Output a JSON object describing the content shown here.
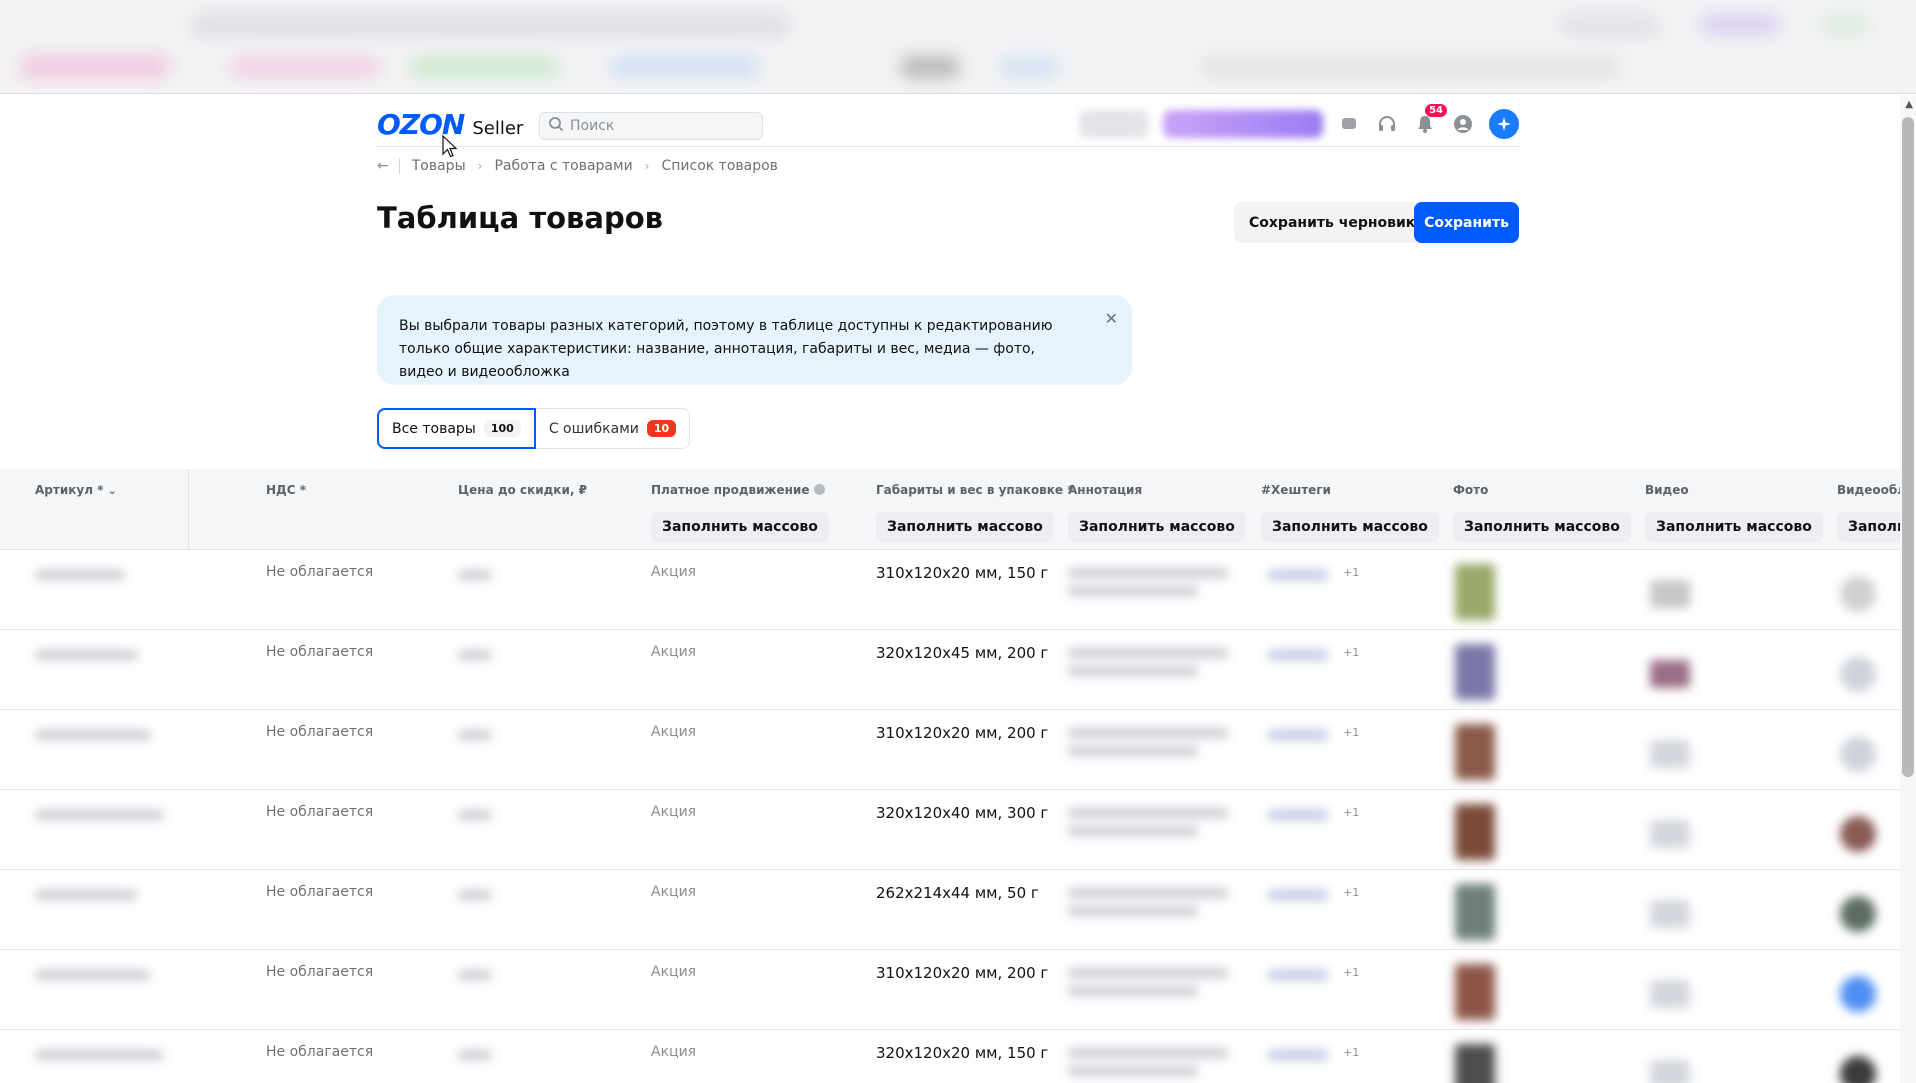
{
  "header": {
    "logo_brand": "OZON",
    "logo_product": "Seller",
    "search_placeholder": "Поиск",
    "notifications_count": "54",
    "icons": [
      "chat-icon",
      "support-icon",
      "bell-icon",
      "profile-icon",
      "ai-assistant-icon"
    ]
  },
  "breadcrumb": {
    "items": [
      "Товары",
      "Работа с товарами",
      "Список товаров"
    ]
  },
  "page": {
    "title": "Таблица товаров",
    "save_draft_label": "Сохранить черновик",
    "save_label": "Сохранить"
  },
  "notice": {
    "text": "Вы выбрали товары разных категорий, поэтому в таблице доступны к редактированию только общие характеристики: название, аннотация, габариты и вес, медиа — фото, видео и видеообложка"
  },
  "tabs": [
    {
      "label": "Все товары",
      "count": "100"
    },
    {
      "label": "С ошибками",
      "count": "10"
    }
  ],
  "table": {
    "columns": {
      "article": "Артикул *",
      "nds": "НДС *",
      "price": "Цена до скидки, ₽",
      "promo": "Платное продвижение",
      "dims": "Габариты и вес в упаковке *",
      "annotation": "Аннотация",
      "hashtags": "#Хештеги",
      "photo": "Фото",
      "video": "Видео",
      "video_cover": "Видеообл"
    },
    "fill_label": "Заполнить массово",
    "fill_label_cut": "Заполн",
    "rows": [
      {
        "nds": "Не облагается",
        "promo": "Акция",
        "dims": "310x120x20 мм, 150 г",
        "hashtag_extra": "+1"
      },
      {
        "nds": "Не облагается",
        "promo": "Акция",
        "dims": "320x120x45 мм, 200 г",
        "hashtag_extra": "+1"
      },
      {
        "nds": "Не облагается",
        "promo": "Акция",
        "dims": "310x120x20 мм, 200 г",
        "hashtag_extra": "+1"
      },
      {
        "nds": "Не облагается",
        "promo": "Акция",
        "dims": "320x120x40 мм, 300 г",
        "hashtag_extra": "+1"
      },
      {
        "nds": "Не облагается",
        "promo": "Акция",
        "dims": "262x214x44 мм, 50 г",
        "hashtag_extra": "+1"
      },
      {
        "nds": "Не облагается",
        "promo": "Акция",
        "dims": "310x120x20 мм, 200 г",
        "hashtag_extra": "+1"
      },
      {
        "nds": "Не облагается",
        "promo": "Акция",
        "dims": "320x120x20 мм, 150 г",
        "hashtag_extra": "+1"
      }
    ]
  },
  "colors": {
    "brand": "#005bff",
    "notice_bg": "#e5f3fc",
    "error_badge": "#f1361d",
    "notification_badge": "#f91155"
  }
}
